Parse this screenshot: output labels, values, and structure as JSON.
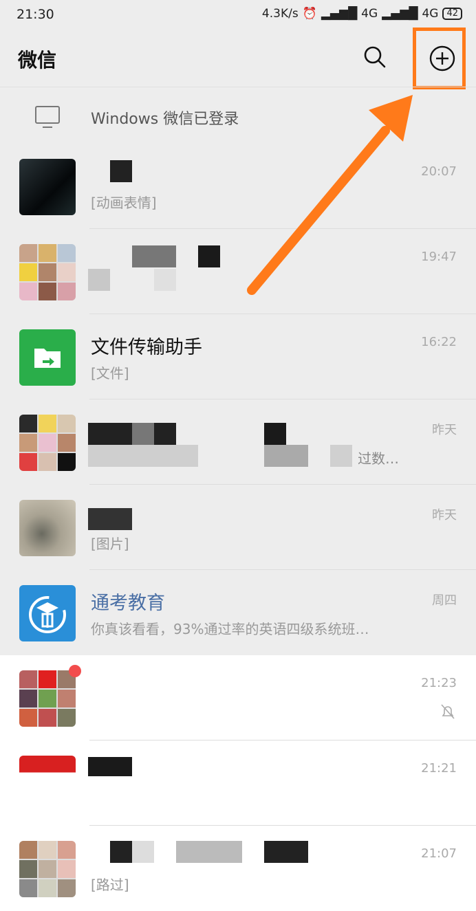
{
  "status_bar": {
    "time": "21:30",
    "speed": "4.3K/s",
    "net1": "4G",
    "net2": "4G",
    "battery": "42"
  },
  "header": {
    "title": "微信"
  },
  "login_notice": {
    "text": "Windows 微信已登录"
  },
  "chats": [
    {
      "name": "",
      "message": "[动画表情]",
      "time": "20:07"
    },
    {
      "name": "",
      "message": "",
      "time": "19:47"
    },
    {
      "name": "文件传输助手",
      "message": "[文件]",
      "time": "16:22"
    },
    {
      "name": "",
      "message": "过数…",
      "time": "昨天"
    },
    {
      "name": "",
      "message": "[图片]",
      "time": "昨天"
    },
    {
      "name": "通考教育",
      "message": "你真该看看，93%通过率的英语四级系统班…",
      "time": "周四"
    },
    {
      "name": "",
      "message": "",
      "time": "21:23"
    },
    {
      "name": "",
      "message": "",
      "time": "21:21"
    },
    {
      "name": "",
      "message": "[路过]",
      "time": "21:07"
    }
  ],
  "colors": {
    "accent_highlight": "#ff7a1a",
    "file_helper_green": "#2aae4a",
    "tongkao_blue": "#2a8fd8"
  }
}
